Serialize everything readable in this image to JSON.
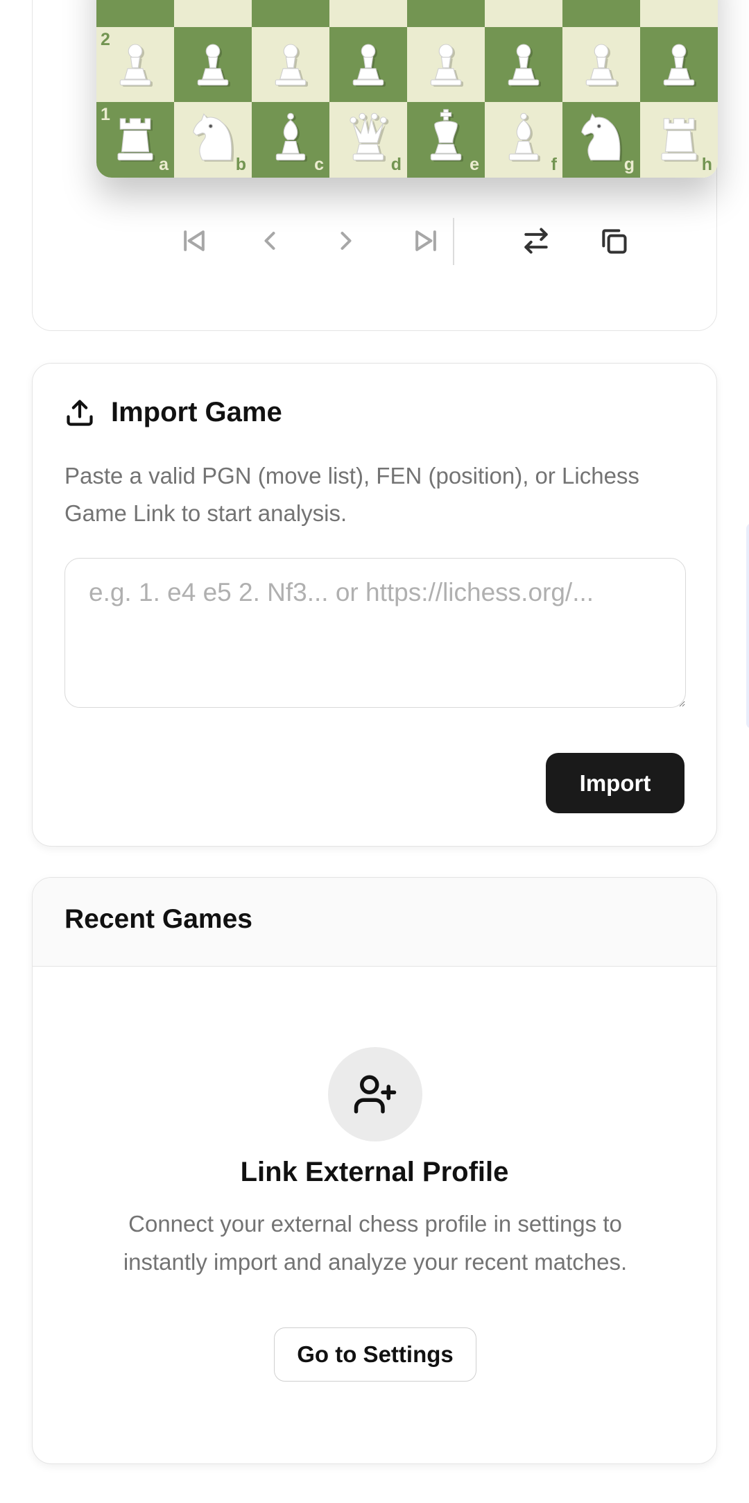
{
  "board": {
    "rank_labels": [
      "",
      "2",
      "1"
    ],
    "file_labels": [
      "a",
      "b",
      "c",
      "d",
      "e",
      "f",
      "g",
      "h"
    ],
    "rows": [
      [
        "",
        "",
        "",
        "",
        "",
        "",
        "",
        ""
      ],
      [
        "P",
        "P",
        "P",
        "P",
        "P",
        "P",
        "P",
        "P"
      ],
      [
        "R",
        "N",
        "B",
        "Q",
        "K",
        "B",
        "N",
        "R"
      ]
    ],
    "colors": {
      "dark_square": "#739552",
      "light_square": "#ebecd0"
    }
  },
  "controls": [
    {
      "name": "first-move-icon",
      "active": false
    },
    {
      "name": "previous-move-icon",
      "active": false
    },
    {
      "name": "next-move-icon",
      "active": false
    },
    {
      "name": "last-move-icon",
      "active": false
    },
    {
      "name": "flip-board-icon",
      "active": true
    },
    {
      "name": "copy-icon",
      "active": true
    }
  ],
  "import": {
    "title": "Import Game",
    "icon": "upload-icon",
    "description": "Paste a valid PGN (move list), FEN (position), or Lichess Game Link to start analysis.",
    "placeholder": "e.g. 1. e4 e5 2. Nf3... or https://lichess.org/...",
    "button_label": "Import"
  },
  "recent": {
    "title": "Recent Games",
    "empty_icon": "user-plus-icon",
    "empty_title": "Link External Profile",
    "empty_description": "Connect your external chess profile in settings to instantly import and analyze your recent matches.",
    "button_label": "Go to Settings"
  }
}
